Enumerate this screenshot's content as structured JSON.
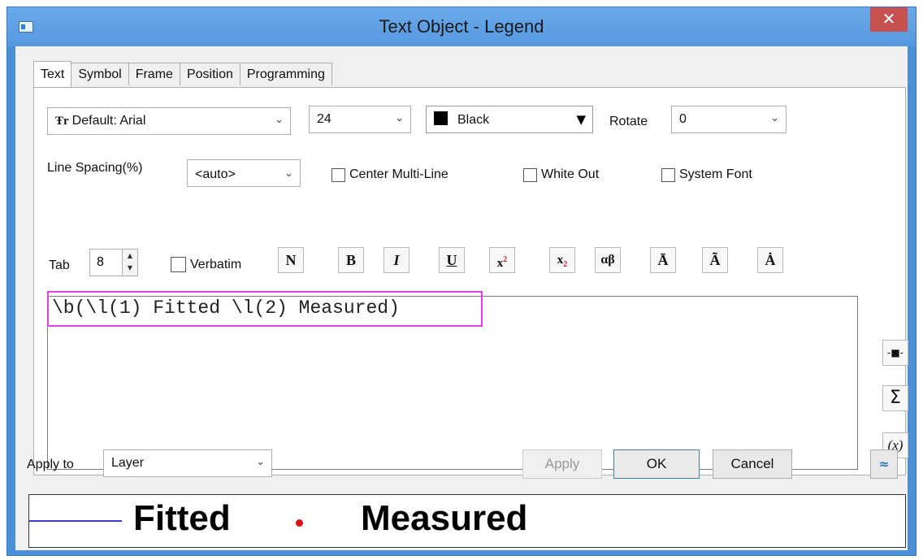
{
  "window": {
    "title": "Text Object - Legend",
    "close_label": "✕"
  },
  "tabs": [
    {
      "label": "Text",
      "active": true
    },
    {
      "label": "Symbol",
      "active": false
    },
    {
      "label": "Frame",
      "active": false
    },
    {
      "label": "Position",
      "active": false
    },
    {
      "label": "Programming",
      "active": false
    }
  ],
  "font": {
    "glyph": "Ŧr",
    "value": "Default: Arial"
  },
  "size": {
    "value": "24"
  },
  "color": {
    "value": "Black",
    "swatch": "#000000"
  },
  "rotate": {
    "label": "Rotate",
    "value": "0"
  },
  "line_spacing": {
    "label": "Line Spacing(%)",
    "value": "<auto>"
  },
  "checkboxes": {
    "center_multiline": {
      "label": "Center Multi-Line",
      "checked": false
    },
    "white_out": {
      "label": "White Out",
      "checked": false
    },
    "system_font": {
      "label": "System Font",
      "checked": false
    },
    "verbatim": {
      "label": "Verbatim",
      "checked": false
    }
  },
  "tab": {
    "label": "Tab",
    "value": "8"
  },
  "format_buttons": {
    "normal": "N",
    "bold": "B",
    "italic": "I",
    "underline": "U",
    "superscript_base": "x",
    "superscript_mark": "2",
    "subscript_base": "x",
    "subscript_mark": "2",
    "greek": "αβ",
    "overbar": "Ā",
    "tilde": "Ã",
    "dot": "Ȧ"
  },
  "editor": {
    "text": "\\b(\\l(1) Fitted \\l(2) Measured)"
  },
  "side_buttons": {
    "symbol": "-■-",
    "sigma": "Σ",
    "variable": "(x)"
  },
  "apply_to": {
    "label": "Apply to",
    "value": "Layer"
  },
  "buttons": {
    "apply": "Apply",
    "ok": "OK",
    "cancel": "Cancel",
    "collapse": "≈"
  },
  "preview": {
    "item1": "Fitted",
    "item2": "Measured",
    "line_color": "#3b3bd0",
    "dot_color": "#e01010"
  }
}
